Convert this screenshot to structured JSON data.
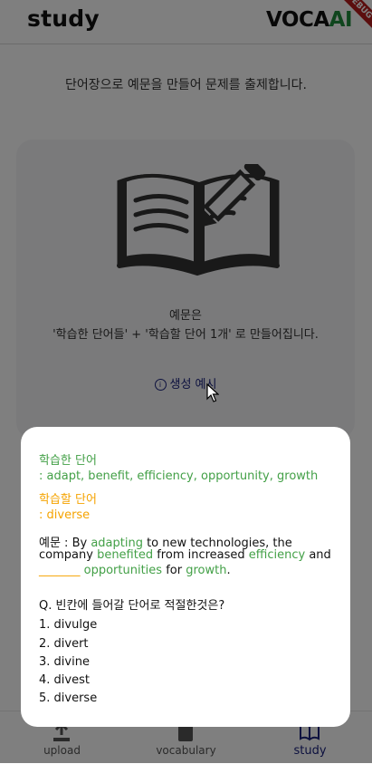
{
  "app": {
    "title": "study",
    "logo_main": "VOCA",
    "logo_accent": "AI",
    "debug_banner": "DEBUG"
  },
  "main": {
    "subtitle": "단어장으로 예문을 만들어 문제를 출제합니다.",
    "card": {
      "illustration": "open-book-with-pencil",
      "description_line1": "예문은",
      "description_line2": "'학습한 단어들' + '학습할 단어 1개' 로 만들어집니다.",
      "example_link": "생성 예시"
    }
  },
  "nav": {
    "items": [
      {
        "label": "upload",
        "icon": "upload-icon"
      },
      {
        "label": "vocabulary",
        "icon": "book-icon"
      },
      {
        "label": "study",
        "icon": "open-book-icon",
        "active": true
      }
    ]
  },
  "dialog": {
    "learned_heading": "학습한 단어",
    "learned_words": ": adapt, benefit, efficiency, opportunity, growth",
    "target_heading": "학습할 단어",
    "target_word": ": diverse",
    "example": {
      "prefix": "예문 : By ",
      "w1": "adapting",
      "t1": " to new technologies, the",
      "t2": "company ",
      "w2": "benefited",
      "t3": " from increased ",
      "w3": "efficiency",
      "t4": " and",
      "blank": "_______",
      "w4": "opportunities",
      "t5": " for ",
      "w5": "growth",
      "t6": "."
    },
    "question": "Q. 빈칸에 들어갈 단어로 적절한것은?",
    "choices": [
      "1. divulge",
      "2. divert",
      "3. divine",
      "4. divest",
      "5. diverse"
    ]
  },
  "colors": {
    "learned": "#43a047",
    "target": "#f5a300",
    "accent": "#1a237e"
  }
}
